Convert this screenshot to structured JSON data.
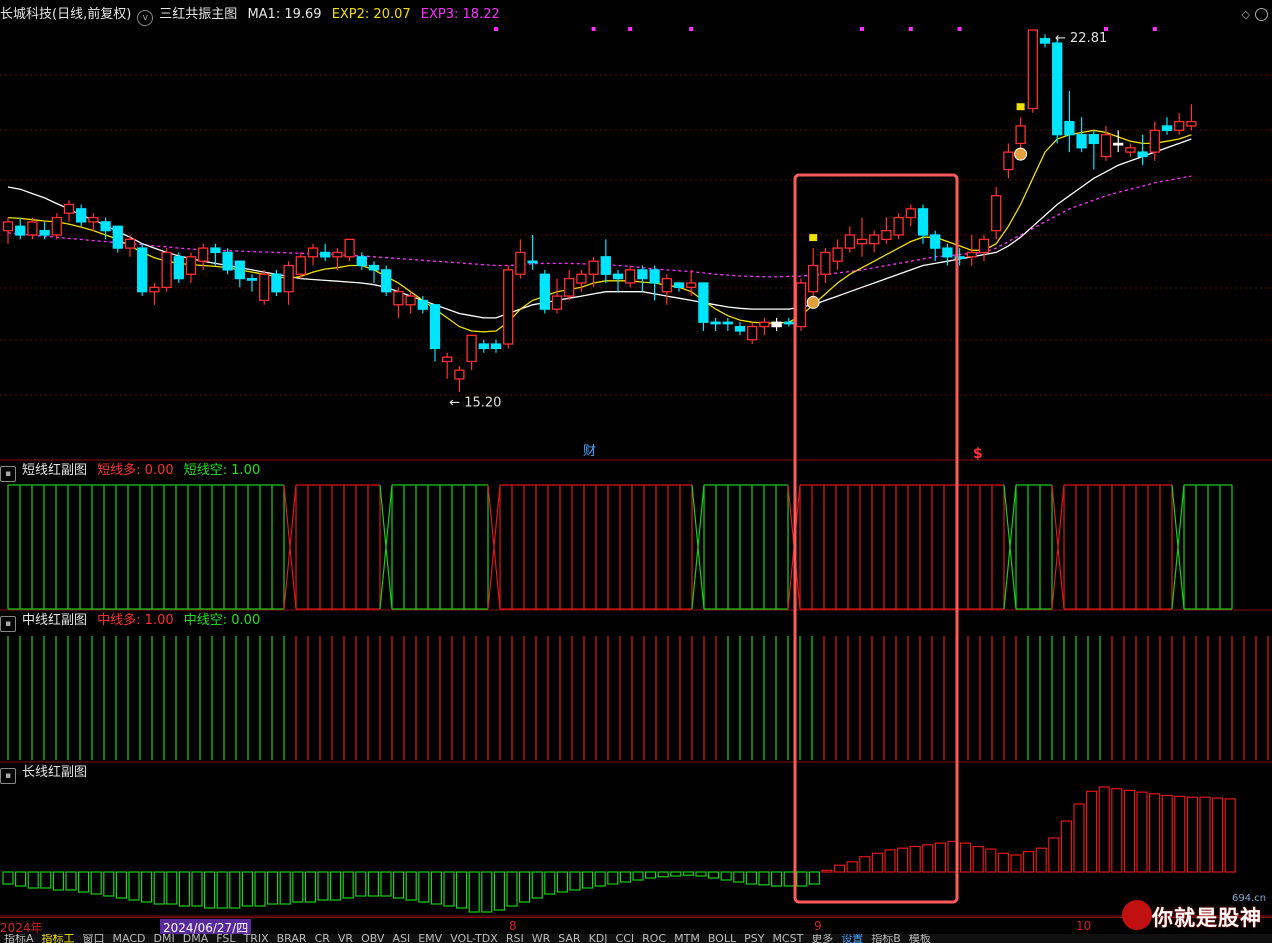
{
  "header": {
    "stock": "长城科技(日线,前复权)",
    "indicator": "三红共振主图",
    "ma1": "MA1: 19.69",
    "exp2": "EXP2: 20.07",
    "exp3": "EXP3: 18.22"
  },
  "subpanes": {
    "short": {
      "title": "短线红副图",
      "bull": "短线多: 0.00",
      "bear": "短线空: 1.00"
    },
    "mid": {
      "title": "中线红副图",
      "bull": "中线多: 1.00",
      "bear": "中线空: 0.00"
    },
    "long": {
      "title": "长线红副图"
    }
  },
  "date_axis": {
    "year": "2024年",
    "selected": "2024/06/27/四",
    "m8": "8",
    "m9": "9",
    "m10": "10"
  },
  "tabs": [
    "指标A",
    "指标工",
    "窗口",
    "MACD",
    "DMI",
    "DMA",
    "FSL",
    "TRIX",
    "BRAR",
    "CR",
    "VR",
    "OBV",
    "ASI",
    "EMV",
    "VOL-TDX",
    "RSI",
    "WR",
    "SAR",
    "KDJ",
    "CCI",
    "ROC",
    "MTM",
    "BOLL",
    "PSY",
    "MCST",
    "更多",
    "设置",
    "指标B",
    "模板"
  ],
  "watermark": {
    "text": "你就是股神",
    "url": "694.cn"
  },
  "colors": {
    "up": "#ff3030",
    "down": "#00e5ff",
    "ma1": "#ffffff",
    "exp2": "#f0e000",
    "exp3": "#ff30ff",
    "bull": "#e01818",
    "bear": "#18d018",
    "box": "#ff5a5a"
  },
  "chart_data": {
    "type": "candlestick",
    "price_range": [
      14.2,
      23.6
    ],
    "annotations": {
      "high": "22.81",
      "low": "15.20",
      "fin_marker": "财",
      "s_marker": "$"
    },
    "candles": [
      [
        19.0,
        19.2,
        18.7,
        19.3,
        "u"
      ],
      [
        19.1,
        18.9,
        18.8,
        19.3,
        "d"
      ],
      [
        18.9,
        19.2,
        18.8,
        19.3,
        "u"
      ],
      [
        19.0,
        18.9,
        18.8,
        19.2,
        "d"
      ],
      [
        18.9,
        19.3,
        18.8,
        19.4,
        "u"
      ],
      [
        19.4,
        19.6,
        19.2,
        19.7,
        "u"
      ],
      [
        19.5,
        19.2,
        19.1,
        19.6,
        "d"
      ],
      [
        19.2,
        19.3,
        19.0,
        19.4,
        "u"
      ],
      [
        19.2,
        19.0,
        18.8,
        19.3,
        "d"
      ],
      [
        19.1,
        18.6,
        18.5,
        19.1,
        "d"
      ],
      [
        18.6,
        18.8,
        18.4,
        18.9,
        "u"
      ],
      [
        18.6,
        17.6,
        17.5,
        18.7,
        "d"
      ],
      [
        17.6,
        17.7,
        17.3,
        17.8,
        "u"
      ],
      [
        17.7,
        18.5,
        17.6,
        18.6,
        "u"
      ],
      [
        18.4,
        17.9,
        17.8,
        18.5,
        "d"
      ],
      [
        18.0,
        18.4,
        17.8,
        18.5,
        "u"
      ],
      [
        18.3,
        18.6,
        18.1,
        18.7,
        "u"
      ],
      [
        18.6,
        18.5,
        18.2,
        18.7,
        "d"
      ],
      [
        18.5,
        18.1,
        18.0,
        18.6,
        "d"
      ],
      [
        18.3,
        17.9,
        17.7,
        18.3,
        "d"
      ],
      [
        17.9,
        17.9,
        17.6,
        18.0,
        "d"
      ],
      [
        17.4,
        18.0,
        17.3,
        18.1,
        "u"
      ],
      [
        18.0,
        17.6,
        17.5,
        18.1,
        "d"
      ],
      [
        17.6,
        18.2,
        17.3,
        18.3,
        "u"
      ],
      [
        18.0,
        18.4,
        17.9,
        18.5,
        "u"
      ],
      [
        18.4,
        18.6,
        18.2,
        18.7,
        "u"
      ],
      [
        18.5,
        18.4,
        18.3,
        18.7,
        "d"
      ],
      [
        18.4,
        18.5,
        18.1,
        18.6,
        "u"
      ],
      [
        18.4,
        18.8,
        18.3,
        18.8,
        "u"
      ],
      [
        18.4,
        18.2,
        18.1,
        18.5,
        "d"
      ],
      [
        18.2,
        18.1,
        17.8,
        18.3,
        "d"
      ],
      [
        18.1,
        17.6,
        17.5,
        18.2,
        "d"
      ],
      [
        17.6,
        17.3,
        17.0,
        17.7,
        "u"
      ],
      [
        17.3,
        17.5,
        17.1,
        17.6,
        "u"
      ],
      [
        17.4,
        17.2,
        17.1,
        17.5,
        "d"
      ],
      [
        17.3,
        16.3,
        16.0,
        17.3,
        "d"
      ],
      [
        16.0,
        16.1,
        15.6,
        16.2,
        "u"
      ],
      [
        15.8,
        15.6,
        15.3,
        15.9,
        "u"
      ],
      [
        16.0,
        16.6,
        15.8,
        16.6,
        "u"
      ],
      [
        16.4,
        16.3,
        16.2,
        16.5,
        "d"
      ],
      [
        16.4,
        16.3,
        16.2,
        16.5,
        "d"
      ],
      [
        16.4,
        18.1,
        16.3,
        18.2,
        "u"
      ],
      [
        18.0,
        18.5,
        17.9,
        18.8,
        "u"
      ],
      [
        18.3,
        18.3,
        18.1,
        18.9,
        "d"
      ],
      [
        18.0,
        17.2,
        17.1,
        18.1,
        "d"
      ],
      [
        17.2,
        17.5,
        17.1,
        17.9,
        "u"
      ],
      [
        17.5,
        17.9,
        17.4,
        18.1,
        "u"
      ],
      [
        17.8,
        18.0,
        17.6,
        18.1,
        "u"
      ],
      [
        18.0,
        18.3,
        17.7,
        18.4,
        "u"
      ],
      [
        18.4,
        18.0,
        17.8,
        18.8,
        "d"
      ],
      [
        18.0,
        17.9,
        17.6,
        18.1,
        "d"
      ],
      [
        17.8,
        18.1,
        17.7,
        18.2,
        "u"
      ],
      [
        18.1,
        17.9,
        17.6,
        18.2,
        "d"
      ],
      [
        18.1,
        17.8,
        17.4,
        18.2,
        "d"
      ],
      [
        17.6,
        17.9,
        17.3,
        18.0,
        "u"
      ],
      [
        17.8,
        17.7,
        17.6,
        17.8,
        "d"
      ],
      [
        17.7,
        17.8,
        17.5,
        18.1,
        "u"
      ],
      [
        17.8,
        16.9,
        16.7,
        17.8,
        "d"
      ],
      [
        16.9,
        16.9,
        16.7,
        17.0,
        "d"
      ],
      [
        16.9,
        16.9,
        16.7,
        17.0,
        "d"
      ],
      [
        16.8,
        16.7,
        16.6,
        16.9,
        "d"
      ],
      [
        16.5,
        16.8,
        16.4,
        16.9,
        "u"
      ],
      [
        16.9,
        16.8,
        16.6,
        17.0,
        "u"
      ],
      [
        16.9,
        16.8,
        16.7,
        17.0,
        "w"
      ],
      [
        16.9,
        16.9,
        16.8,
        17.0,
        "d"
      ],
      [
        16.8,
        17.8,
        16.7,
        17.9,
        "u"
      ],
      [
        17.6,
        18.2,
        17.4,
        18.6,
        "u"
      ],
      [
        18.0,
        18.5,
        17.8,
        18.6,
        "u"
      ],
      [
        18.3,
        18.6,
        18.1,
        18.8,
        "u"
      ],
      [
        18.6,
        18.9,
        18.5,
        19.1,
        "u"
      ],
      [
        18.7,
        18.8,
        18.4,
        19.3,
        "u"
      ],
      [
        18.7,
        18.9,
        18.5,
        19.0,
        "u"
      ],
      [
        18.8,
        19.0,
        18.7,
        19.3,
        "u"
      ],
      [
        18.9,
        19.3,
        18.8,
        19.4,
        "u"
      ],
      [
        19.3,
        19.5,
        19.1,
        19.6,
        "u"
      ],
      [
        19.5,
        18.9,
        18.7,
        19.6,
        "d"
      ],
      [
        18.9,
        18.6,
        18.3,
        19.0,
        "d"
      ],
      [
        18.6,
        18.4,
        18.2,
        18.7,
        "d"
      ],
      [
        18.4,
        18.4,
        18.2,
        18.6,
        "d"
      ],
      [
        18.4,
        18.5,
        18.2,
        18.9,
        "u"
      ],
      [
        18.5,
        18.8,
        18.3,
        18.9,
        "u"
      ],
      [
        19.0,
        19.8,
        18.8,
        20.0,
        "u"
      ],
      [
        20.4,
        20.8,
        20.2,
        21.0,
        "u"
      ],
      [
        21.0,
        21.4,
        20.8,
        21.6,
        "u"
      ],
      [
        21.8,
        23.6,
        21.7,
        23.6,
        "u"
      ],
      [
        23.3,
        23.4,
        23.2,
        23.5,
        "d"
      ],
      [
        23.3,
        21.2,
        21.0,
        23.4,
        "d"
      ],
      [
        21.5,
        21.2,
        20.8,
        22.2,
        "d"
      ],
      [
        21.2,
        20.9,
        20.8,
        21.6,
        "d"
      ],
      [
        21.2,
        21.0,
        20.4,
        21.3,
        "d"
      ],
      [
        20.7,
        21.2,
        20.6,
        21.4,
        "u"
      ],
      [
        21.0,
        21.0,
        20.8,
        21.3,
        "w"
      ],
      [
        20.9,
        20.8,
        20.7,
        21.0,
        "u"
      ],
      [
        20.8,
        20.7,
        20.5,
        21.2,
        "d"
      ],
      [
        20.8,
        21.3,
        20.6,
        21.5,
        "u"
      ],
      [
        21.4,
        21.3,
        21.2,
        21.6,
        "d"
      ],
      [
        21.3,
        21.5,
        21.2,
        21.7,
        "u"
      ],
      [
        21.5,
        21.4,
        21.3,
        21.9,
        "u"
      ]
    ],
    "ma_white": [
      20.0,
      19.95,
      19.85,
      19.75,
      19.62,
      19.5,
      19.35,
      19.25,
      19.12,
      18.98,
      18.85,
      18.7,
      18.6,
      18.5,
      18.42,
      18.36,
      18.3,
      18.25,
      18.2,
      18.15,
      18.1,
      18.05,
      18.0,
      17.95,
      17.9,
      17.88,
      17.86,
      17.84,
      17.82,
      17.8,
      17.76,
      17.7,
      17.6,
      17.5,
      17.4,
      17.3,
      17.2,
      17.1,
      17.05,
      17.0,
      17.0,
      17.1,
      17.2,
      17.3,
      17.35,
      17.4,
      17.45,
      17.5,
      17.55,
      17.6,
      17.6,
      17.6,
      17.6,
      17.55,
      17.5,
      17.45,
      17.4,
      17.35,
      17.3,
      17.25,
      17.22,
      17.2,
      17.2,
      17.2,
      17.2,
      17.25,
      17.3,
      17.4,
      17.5,
      17.6,
      17.7,
      17.8,
      17.9,
      18.0,
      18.1,
      18.2,
      18.25,
      18.3,
      18.35,
      18.4,
      18.45,
      18.5,
      18.65,
      18.85,
      19.1,
      19.35,
      19.6,
      19.8,
      20.0,
      20.2,
      20.35,
      20.5,
      20.6,
      20.7,
      20.8,
      20.9,
      21.0,
      21.1
    ],
    "ma_yellow": [
      19.3,
      19.28,
      19.25,
      19.22,
      19.2,
      19.15,
      19.08,
      19.0,
      18.9,
      18.8,
      18.65,
      18.5,
      18.38,
      18.3,
      18.25,
      18.22,
      18.2,
      18.18,
      18.15,
      18.1,
      18.05,
      18.0,
      17.95,
      17.9,
      17.95,
      18.05,
      18.12,
      18.15,
      18.2,
      18.2,
      18.1,
      17.95,
      17.8,
      17.6,
      17.4,
      17.2,
      17.0,
      16.8,
      16.7,
      16.68,
      16.7,
      16.9,
      17.2,
      17.4,
      17.5,
      17.6,
      17.65,
      17.7,
      17.8,
      17.85,
      17.85,
      17.85,
      17.82,
      17.8,
      17.75,
      17.7,
      17.6,
      17.4,
      17.2,
      17.05,
      16.95,
      16.9,
      16.88,
      16.88,
      16.9,
      17.05,
      17.3,
      17.55,
      17.8,
      18.0,
      18.15,
      18.3,
      18.45,
      18.6,
      18.75,
      18.85,
      18.85,
      18.75,
      18.65,
      18.55,
      18.55,
      18.7,
      19.1,
      19.6,
      20.2,
      20.8,
      21.1,
      21.2,
      21.25,
      21.3,
      21.25,
      21.15,
      21.05,
      21.0,
      21.0,
      21.05,
      21.1,
      21.2
    ],
    "ma_magenta": [
      18.95,
      18.92,
      18.9,
      18.87,
      18.85,
      18.82,
      18.8,
      18.77,
      18.75,
      18.72,
      18.7,
      18.68,
      18.65,
      18.63,
      18.6,
      18.58,
      18.56,
      18.55,
      18.54,
      18.53,
      18.52,
      18.51,
      18.5,
      18.49,
      18.48,
      18.47,
      18.46,
      18.45,
      18.43,
      18.42,
      18.4,
      18.38,
      18.36,
      18.34,
      18.32,
      18.3,
      18.28,
      18.26,
      18.24,
      18.22,
      18.2,
      18.2,
      18.22,
      18.24,
      18.25,
      18.25,
      18.25,
      18.24,
      18.23,
      18.22,
      18.2,
      18.18,
      18.15,
      18.12,
      18.1,
      18.08,
      18.06,
      18.03,
      18.0,
      17.98,
      17.96,
      17.95,
      17.94,
      17.94,
      17.95,
      17.96,
      17.98,
      18.0,
      18.03,
      18.06,
      18.1,
      18.15,
      18.2,
      18.25,
      18.3,
      18.35,
      18.4,
      18.42,
      18.45,
      18.48,
      18.5,
      18.6,
      18.75,
      18.9,
      19.05,
      19.2,
      19.35,
      19.5,
      19.6,
      19.7,
      19.8,
      19.88,
      19.95,
      20.02,
      20.1,
      20.15,
      20.2,
      20.25
    ],
    "short_signal": [
      0,
      0,
      0,
      0,
      0,
      0,
      0,
      0,
      0,
      0,
      0,
      0,
      0,
      0,
      0,
      0,
      0,
      0,
      0,
      0,
      0,
      0,
      0,
      0,
      1,
      1,
      1,
      1,
      1,
      1,
      1,
      1,
      0,
      0,
      0,
      0,
      0,
      0,
      0,
      0,
      0,
      1,
      1,
      1,
      1,
      1,
      1,
      1,
      1,
      1,
      1,
      1,
      1,
      1,
      1,
      1,
      1,
      1,
      0,
      0,
      0,
      0,
      0,
      0,
      0,
      0,
      1,
      1,
      1,
      1,
      1,
      1,
      1,
      1,
      1,
      1,
      1,
      1,
      1,
      1,
      1,
      1,
      1,
      1,
      0,
      0,
      0,
      0,
      1,
      1,
      1,
      1,
      1,
      1,
      1,
      1,
      1,
      1,
      0,
      0,
      0,
      0,
      0
    ],
    "mid_signal": [
      0,
      0,
      0,
      0,
      0,
      0,
      0,
      0,
      0,
      0,
      0,
      0,
      0,
      0,
      0,
      0,
      0,
      0,
      0,
      0,
      0,
      0,
      0,
      0,
      1,
      1,
      1,
      1,
      1,
      1,
      1,
      1,
      1,
      1,
      1,
      1,
      1,
      1,
      1,
      1,
      1,
      1,
      1,
      1,
      1,
      1,
      1,
      1,
      1,
      1,
      1,
      1,
      1,
      1,
      1,
      1,
      1,
      1,
      1,
      1,
      0,
      0,
      0,
      0,
      0,
      0,
      0,
      0,
      1,
      1,
      1,
      1,
      1,
      1,
      1,
      1,
      1,
      1,
      1,
      1,
      1,
      1,
      1,
      1,
      1,
      0,
      0,
      0,
      0,
      0,
      0,
      0,
      1,
      1,
      1,
      1,
      1,
      1,
      1,
      1,
      1,
      1,
      1,
      1,
      1,
      1,
      1,
      1
    ],
    "long_values": [
      -0.3,
      -0.35,
      -0.4,
      -0.4,
      -0.45,
      -0.45,
      -0.5,
      -0.55,
      -0.6,
      -0.65,
      -0.7,
      -0.75,
      -0.8,
      -0.8,
      -0.85,
      -0.85,
      -0.9,
      -0.9,
      -0.9,
      -0.85,
      -0.85,
      -0.8,
      -0.8,
      -0.75,
      -0.75,
      -0.7,
      -0.7,
      -0.65,
      -0.6,
      -0.6,
      -0.6,
      -0.65,
      -0.7,
      -0.75,
      -0.8,
      -0.85,
      -0.9,
      -1.0,
      -1.0,
      -0.95,
      -0.85,
      -0.75,
      -0.65,
      -0.55,
      -0.5,
      -0.45,
      -0.4,
      -0.35,
      -0.3,
      -0.25,
      -0.2,
      -0.15,
      -0.12,
      -0.1,
      -0.08,
      -0.1,
      -0.15,
      -0.2,
      -0.25,
      -0.3,
      -0.32,
      -0.35,
      -0.35,
      -0.35,
      -0.3,
      0.02,
      0.08,
      0.12,
      0.18,
      0.22,
      0.26,
      0.28,
      0.3,
      0.32,
      0.34,
      0.36,
      0.34,
      0.3,
      0.27,
      0.22,
      0.2,
      0.24,
      0.28,
      0.4,
      0.6,
      0.8,
      0.95,
      1.0,
      0.98,
      0.96,
      0.94,
      0.92,
      0.9,
      0.89,
      0.88,
      0.88,
      0.87,
      0.86
    ]
  }
}
